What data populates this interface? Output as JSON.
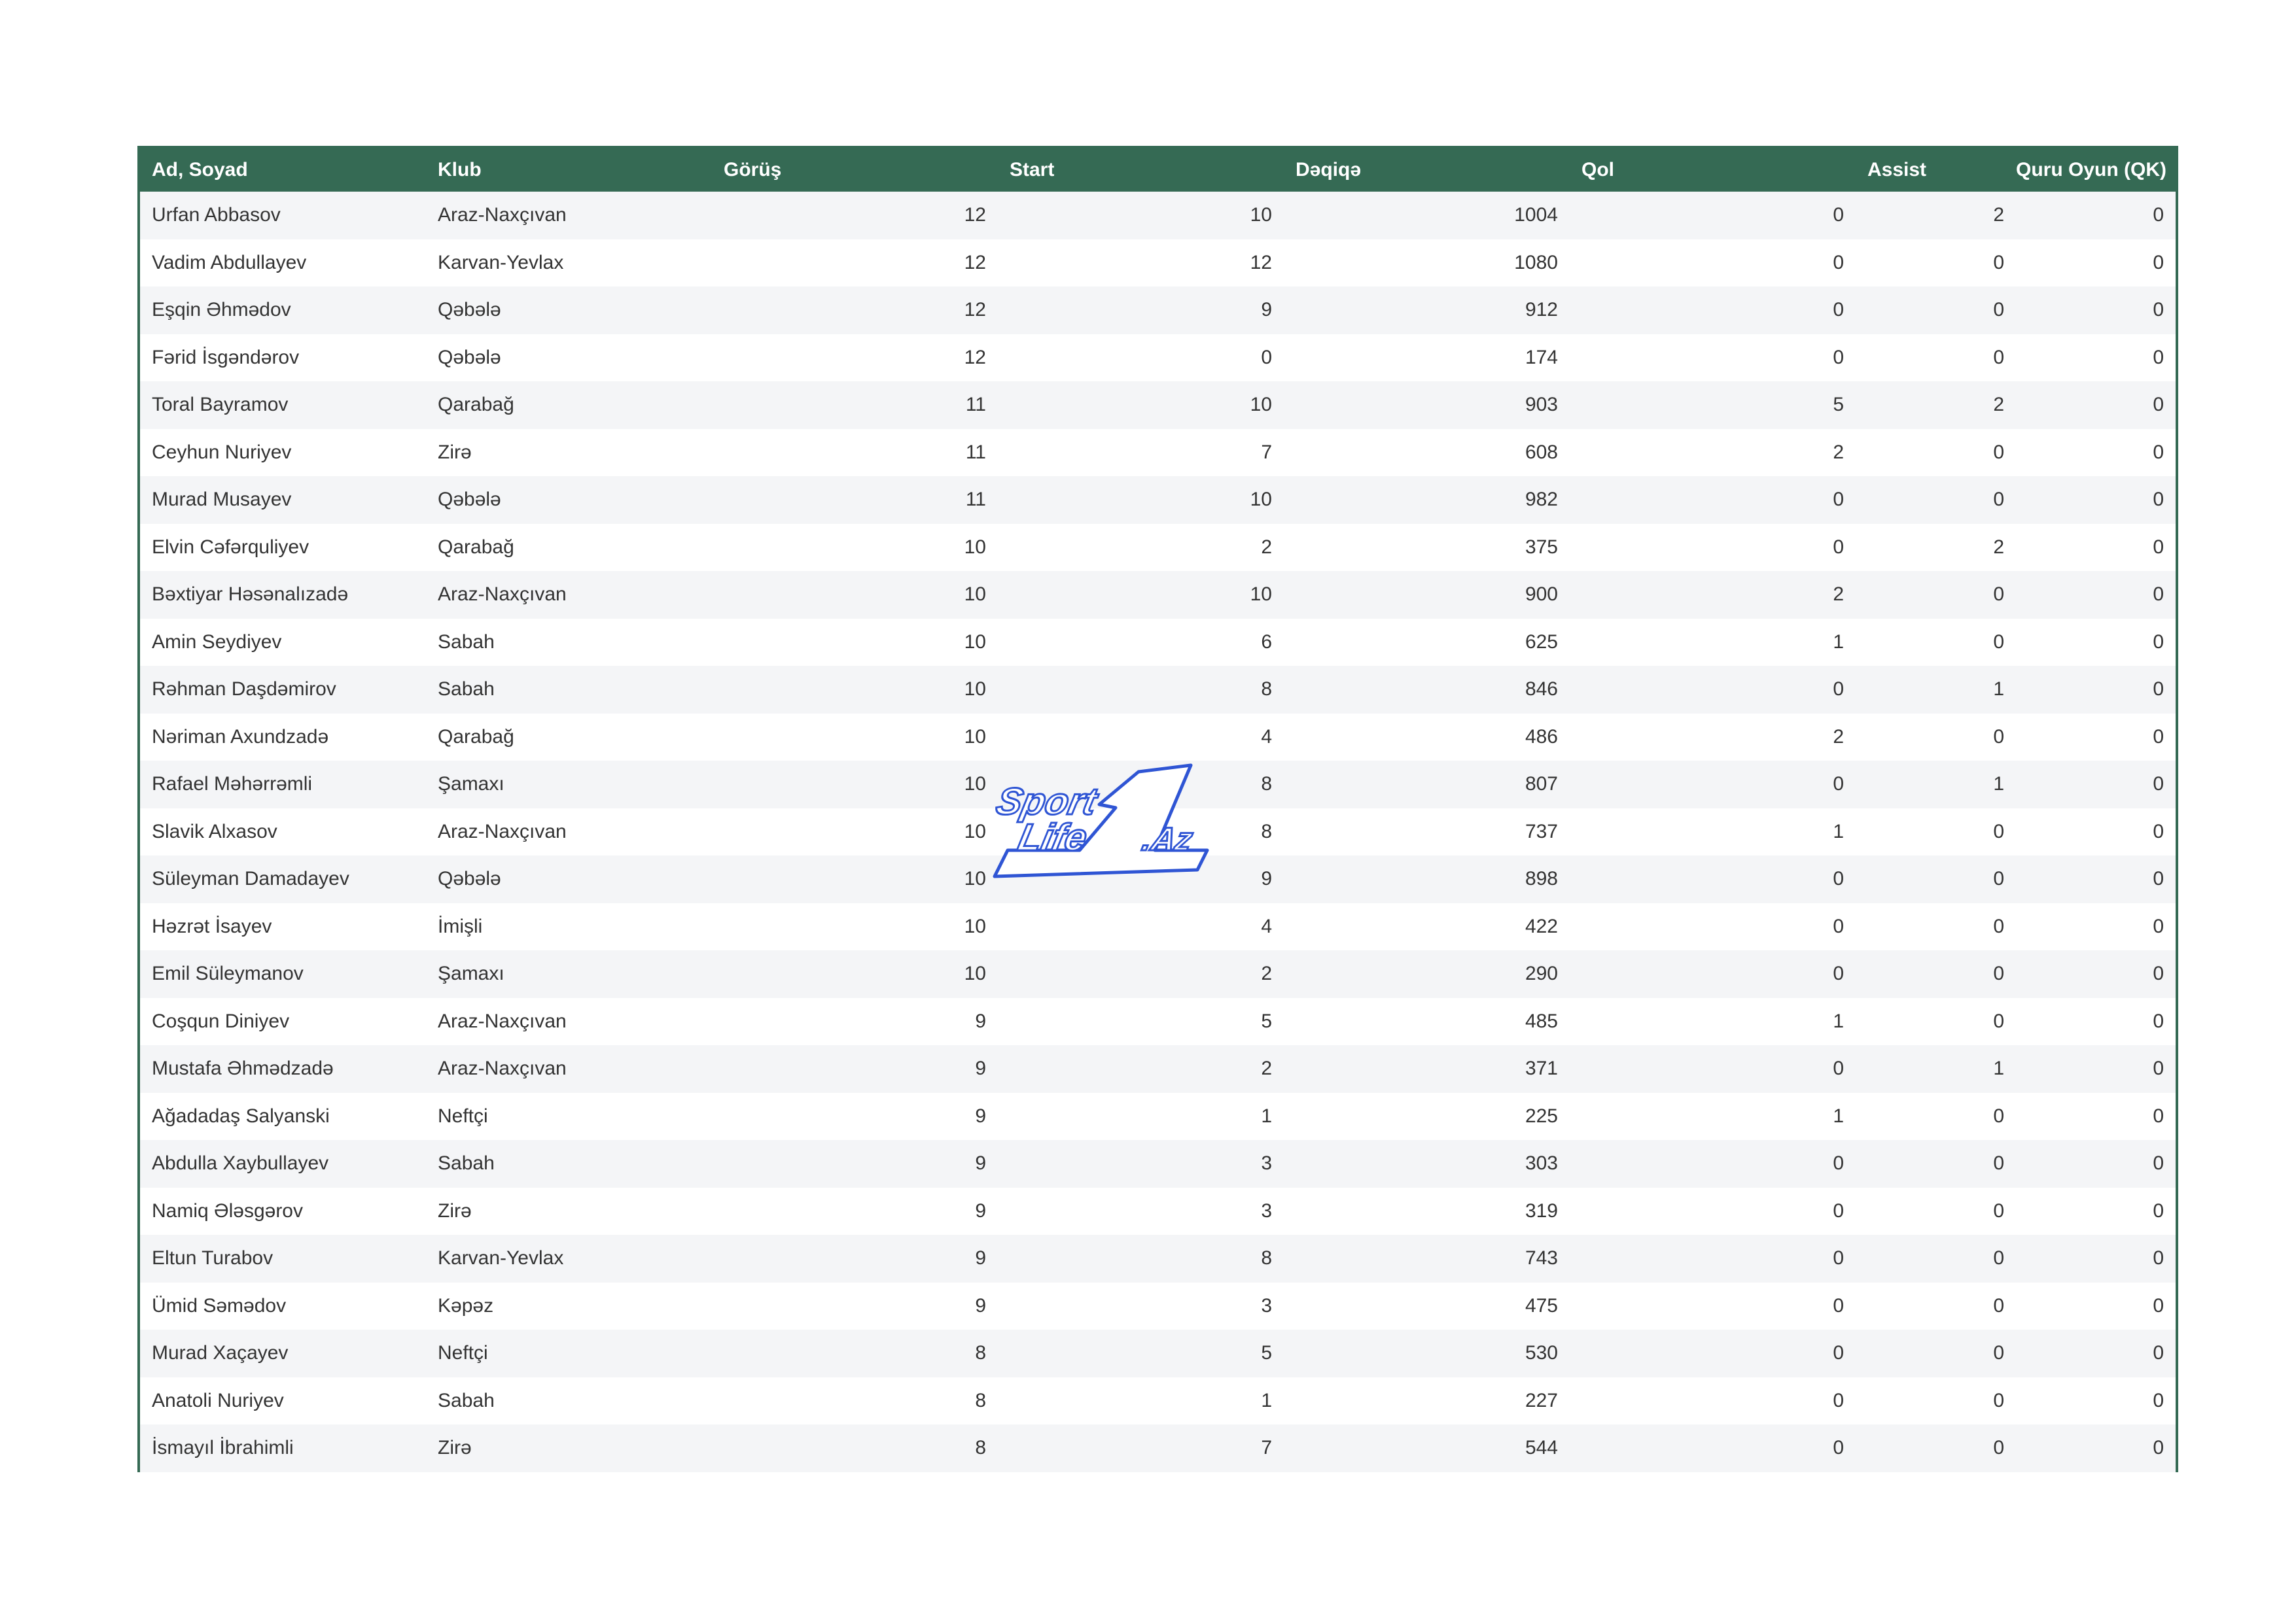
{
  "table": {
    "headers": [
      "Ad, Soyad",
      "Klub",
      "Görüş",
      "Start",
      "Dəqiqə",
      "Qol",
      "Assist",
      "Quru Oyun (QK)"
    ],
    "rows": [
      [
        "Urfan Abbasov",
        "Araz-Naxçıvan",
        "12",
        "10",
        "1004",
        "0",
        "2",
        "0"
      ],
      [
        "Vadim Abdullayev",
        "Karvan-Yevlax",
        "12",
        "12",
        "1080",
        "0",
        "0",
        "0"
      ],
      [
        "Eşqin Əhmədov",
        "Qəbələ",
        "12",
        "9",
        "912",
        "0",
        "0",
        "0"
      ],
      [
        "Fərid İsgəndərov",
        "Qəbələ",
        "12",
        "0",
        "174",
        "0",
        "0",
        "0"
      ],
      [
        "Toral Bayramov",
        "Qarabağ",
        "11",
        "10",
        "903",
        "5",
        "2",
        "0"
      ],
      [
        "Ceyhun Nuriyev",
        "Zirə",
        "11",
        "7",
        "608",
        "2",
        "0",
        "0"
      ],
      [
        "Murad Musayev",
        "Qəbələ",
        "11",
        "10",
        "982",
        "0",
        "0",
        "0"
      ],
      [
        "Elvin Cəfərquliyev",
        "Qarabağ",
        "10",
        "2",
        "375",
        "0",
        "2",
        "0"
      ],
      [
        "Bəxtiyar Həsənalızadə",
        "Araz-Naxçıvan",
        "10",
        "10",
        "900",
        "2",
        "0",
        "0"
      ],
      [
        "Amin Seydiyev",
        "Sabah",
        "10",
        "6",
        "625",
        "1",
        "0",
        "0"
      ],
      [
        "Rəhman Daşdəmirov",
        "Sabah",
        "10",
        "8",
        "846",
        "0",
        "1",
        "0"
      ],
      [
        "Nəriman Axundzadə",
        "Qarabağ",
        "10",
        "4",
        "486",
        "2",
        "0",
        "0"
      ],
      [
        "Rafael Məhərrəmli",
        "Şamaxı",
        "10",
        "8",
        "807",
        "0",
        "1",
        "0"
      ],
      [
        "Slavik Alxasov",
        "Araz-Naxçıvan",
        "10",
        "8",
        "737",
        "1",
        "0",
        "0"
      ],
      [
        "Süleyman Damadayev",
        "Qəbələ",
        "10",
        "9",
        "898",
        "0",
        "0",
        "0"
      ],
      [
        "Həzrət İsayev",
        "İmişli",
        "10",
        "4",
        "422",
        "0",
        "0",
        "0"
      ],
      [
        "Emil Süleymanov",
        "Şamaxı",
        "10",
        "2",
        "290",
        "0",
        "0",
        "0"
      ],
      [
        "Coşqun Diniyev",
        "Araz-Naxçıvan",
        "9",
        "5",
        "485",
        "1",
        "0",
        "0"
      ],
      [
        "Mustafa Əhmədzadə",
        "Araz-Naxçıvan",
        "9",
        "2",
        "371",
        "0",
        "1",
        "0"
      ],
      [
        "Ağadadaş Salyanski",
        "Neftçi",
        "9",
        "1",
        "225",
        "1",
        "0",
        "0"
      ],
      [
        "Abdulla Xaybullayev",
        "Sabah",
        "9",
        "3",
        "303",
        "0",
        "0",
        "0"
      ],
      [
        "Namiq Ələsgərov",
        "Zirə",
        "9",
        "3",
        "319",
        "0",
        "0",
        "0"
      ],
      [
        "Eltun Turabov",
        "Karvan-Yevlax",
        "9",
        "8",
        "743",
        "0",
        "0",
        "0"
      ],
      [
        "Ümid Səmədov",
        "Kəpəz",
        "9",
        "3",
        "475",
        "0",
        "0",
        "0"
      ],
      [
        "Murad Xaçayev",
        "Neftçi",
        "8",
        "5",
        "530",
        "0",
        "0",
        "0"
      ],
      [
        "Anatoli Nuriyev",
        "Sabah",
        "8",
        "1",
        "227",
        "0",
        "0",
        "0"
      ],
      [
        "İsmayıl İbrahimli",
        "Zirə",
        "8",
        "7",
        "544",
        "0",
        "0",
        "0"
      ]
    ]
  },
  "watermark": {
    "line1": "Sport",
    "line2": "Life",
    "numeral": "1",
    "suffix": ".Az",
    "color": "#2f55d4"
  },
  "colors": {
    "header_bg": "#356a54",
    "header_text": "#ffffff",
    "row_stripe": "#f4f5f7",
    "cell_text": "#333333"
  }
}
